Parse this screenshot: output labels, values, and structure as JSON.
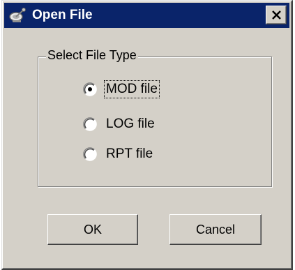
{
  "window": {
    "title": "Open File",
    "title_icon": "satellite-dish-icon",
    "close_icon": "close-icon"
  },
  "group": {
    "legend": "Select File Type",
    "options": [
      {
        "label": "MOD file",
        "selected": true
      },
      {
        "label": "LOG file",
        "selected": false
      },
      {
        "label": "RPT file",
        "selected": false
      }
    ]
  },
  "buttons": {
    "ok_label": "OK",
    "cancel_label": "Cancel"
  },
  "colors": {
    "titlebar": "#0a246a",
    "dialog_face": "#d4d0c8"
  }
}
